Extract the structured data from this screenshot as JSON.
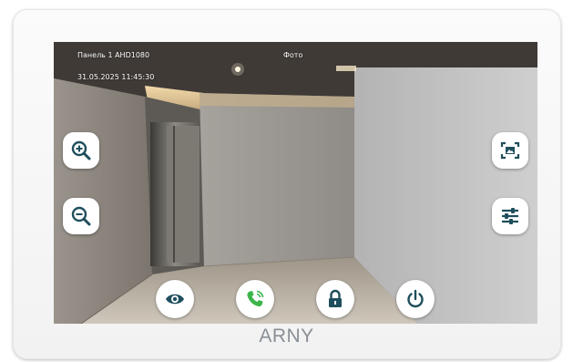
{
  "header": {
    "camera_label": "Панель 1 AHD1080",
    "mode_label": "Фото",
    "datetime": "31.05.2025 11:45:30"
  },
  "left_controls": [
    {
      "name": "zoom-in",
      "icon": "zoom-in-icon"
    },
    {
      "name": "zoom-out",
      "icon": "zoom-out-icon"
    }
  ],
  "right_controls": [
    {
      "name": "snapshot",
      "icon": "snapshot-icon"
    },
    {
      "name": "settings",
      "icon": "sliders-icon"
    }
  ],
  "bottom_controls": [
    {
      "name": "monitor",
      "icon": "eye-icon"
    },
    {
      "name": "answer-call",
      "icon": "phone-icon"
    },
    {
      "name": "unlock",
      "icon": "lock-icon"
    },
    {
      "name": "power",
      "icon": "power-icon"
    }
  ],
  "brand": {
    "logo_text": "ARNY"
  },
  "colors": {
    "icon_primary": "#1f4e5c",
    "icon_call": "#3db54a",
    "button_bg": "#ffffff",
    "brand": "#8a8f96"
  }
}
